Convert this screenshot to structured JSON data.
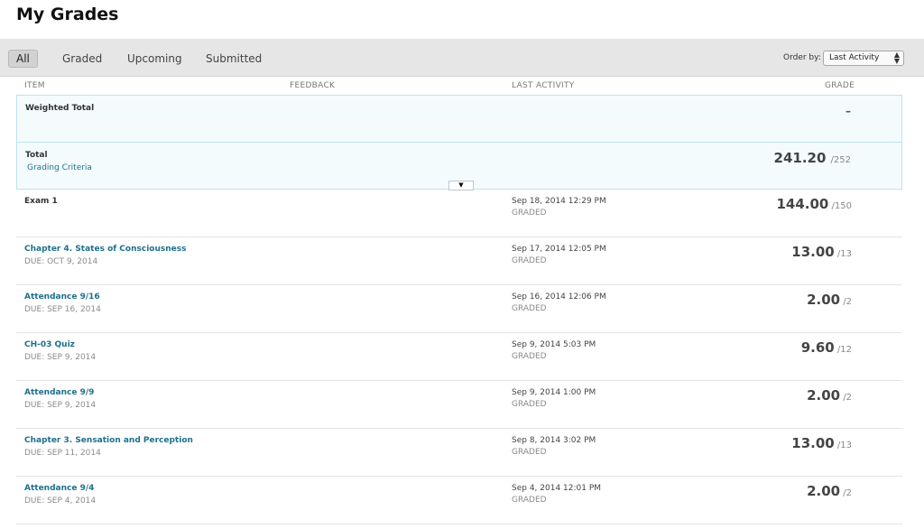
{
  "page_title": "My Grades",
  "filters": [
    {
      "label": "All",
      "active": true
    },
    {
      "label": "Graded",
      "active": false
    },
    {
      "label": "Upcoming",
      "active": false
    },
    {
      "label": "Submitted",
      "active": false
    }
  ],
  "order_by": {
    "label": "Order by:",
    "selected": "Last Activity"
  },
  "columns": {
    "item": "ITEM",
    "feedback": "FEEDBACK",
    "last_activity": "LAST ACTIVITY",
    "grade": "GRADE"
  },
  "weighted_total": {
    "label": "Weighted Total",
    "value": "–"
  },
  "total": {
    "label": "Total",
    "link": "Grading Criteria",
    "score": "241.20",
    "max": "/252"
  },
  "rows": [
    {
      "title": "Exam 1",
      "due": "",
      "date": "Sep 18, 2014 12:29 PM",
      "status": "GRADED",
      "score": "144.00",
      "max": "/150"
    },
    {
      "title": "Chapter 4. States of Consciousness",
      "due": "DUE: OCT 9, 2014",
      "date": "Sep 17, 2014 12:05 PM",
      "status": "GRADED",
      "score": "13.00",
      "max": "/13"
    },
    {
      "title": "Attendance 9/16",
      "due": "DUE: SEP 16, 2014",
      "date": "Sep 16, 2014 12:06 PM",
      "status": "GRADED",
      "score": "2.00",
      "max": "/2"
    },
    {
      "title": "CH-03 Quiz",
      "due": "DUE: SEP 9, 2014",
      "date": "Sep 9, 2014 5:03 PM",
      "status": "GRADED",
      "score": "9.60",
      "max": "/12"
    },
    {
      "title": "Attendance 9/9",
      "due": "DUE: SEP 9, 2014",
      "date": "Sep 9, 2014 1:00 PM",
      "status": "GRADED",
      "score": "2.00",
      "max": "/2"
    },
    {
      "title": "Chapter 3. Sensation and Perception",
      "due": "DUE: SEP 11, 2014",
      "date": "Sep 8, 2014 3:02 PM",
      "status": "GRADED",
      "score": "13.00",
      "max": "/13"
    },
    {
      "title": "Attendance 9/4",
      "due": "DUE: SEP 4, 2014",
      "date": "Sep 4, 2014 12:01 PM",
      "status": "GRADED",
      "score": "2.00",
      "max": "/2"
    }
  ],
  "icons": {
    "expand": "chevron-down-icon",
    "select": "select-arrows-icon"
  },
  "colors": {
    "link": "#1f6f8b",
    "summary_bg": "#f4fbfd",
    "summary_border": "#bfe2ef",
    "filterbar_bg": "#e6e6e6"
  }
}
